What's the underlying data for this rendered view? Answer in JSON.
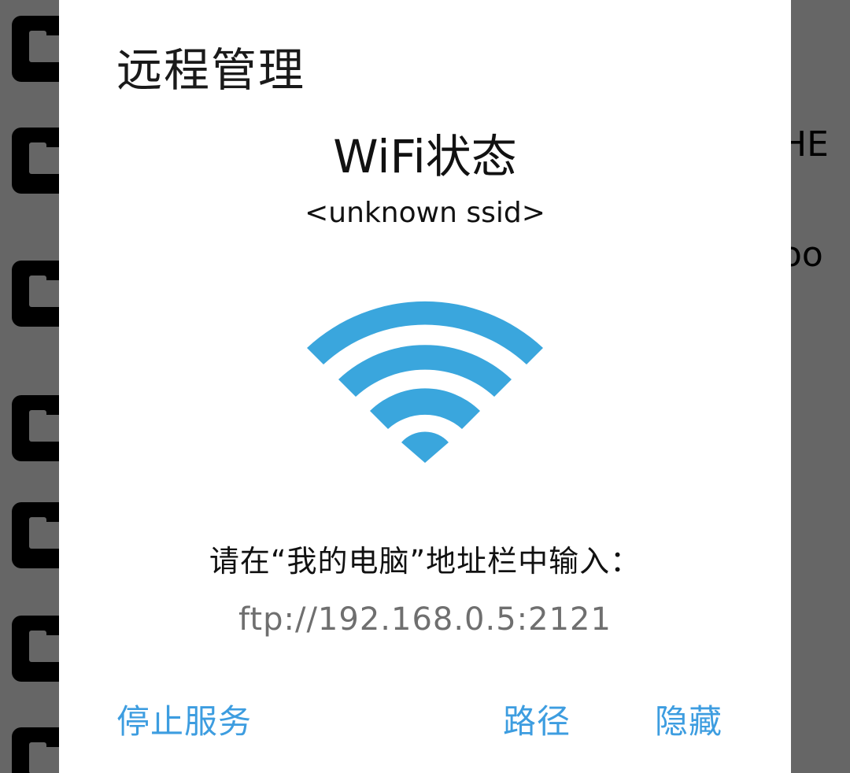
{
  "background": {
    "rows": [
      {
        "text": ""
      },
      {
        "text": "HE"
      },
      {
        "text": "oo"
      },
      {
        "text": ""
      },
      {
        "text": ""
      },
      {
        "text": ""
      },
      {
        "text": ""
      }
    ]
  },
  "dialog": {
    "title": "远程管理",
    "status_title": "WiFi状态",
    "ssid": "<unknown ssid>",
    "wifi_icon": "wifi-icon",
    "wifi_color": "#3aa6dd",
    "hint": "请在“我的电脑”地址栏中输入：",
    "ftp_address": "ftp://192.168.0.5:2121",
    "buttons": {
      "stop": "停止服务",
      "path": "路径",
      "hide": "隐藏"
    },
    "button_color": "#3d9de0"
  }
}
